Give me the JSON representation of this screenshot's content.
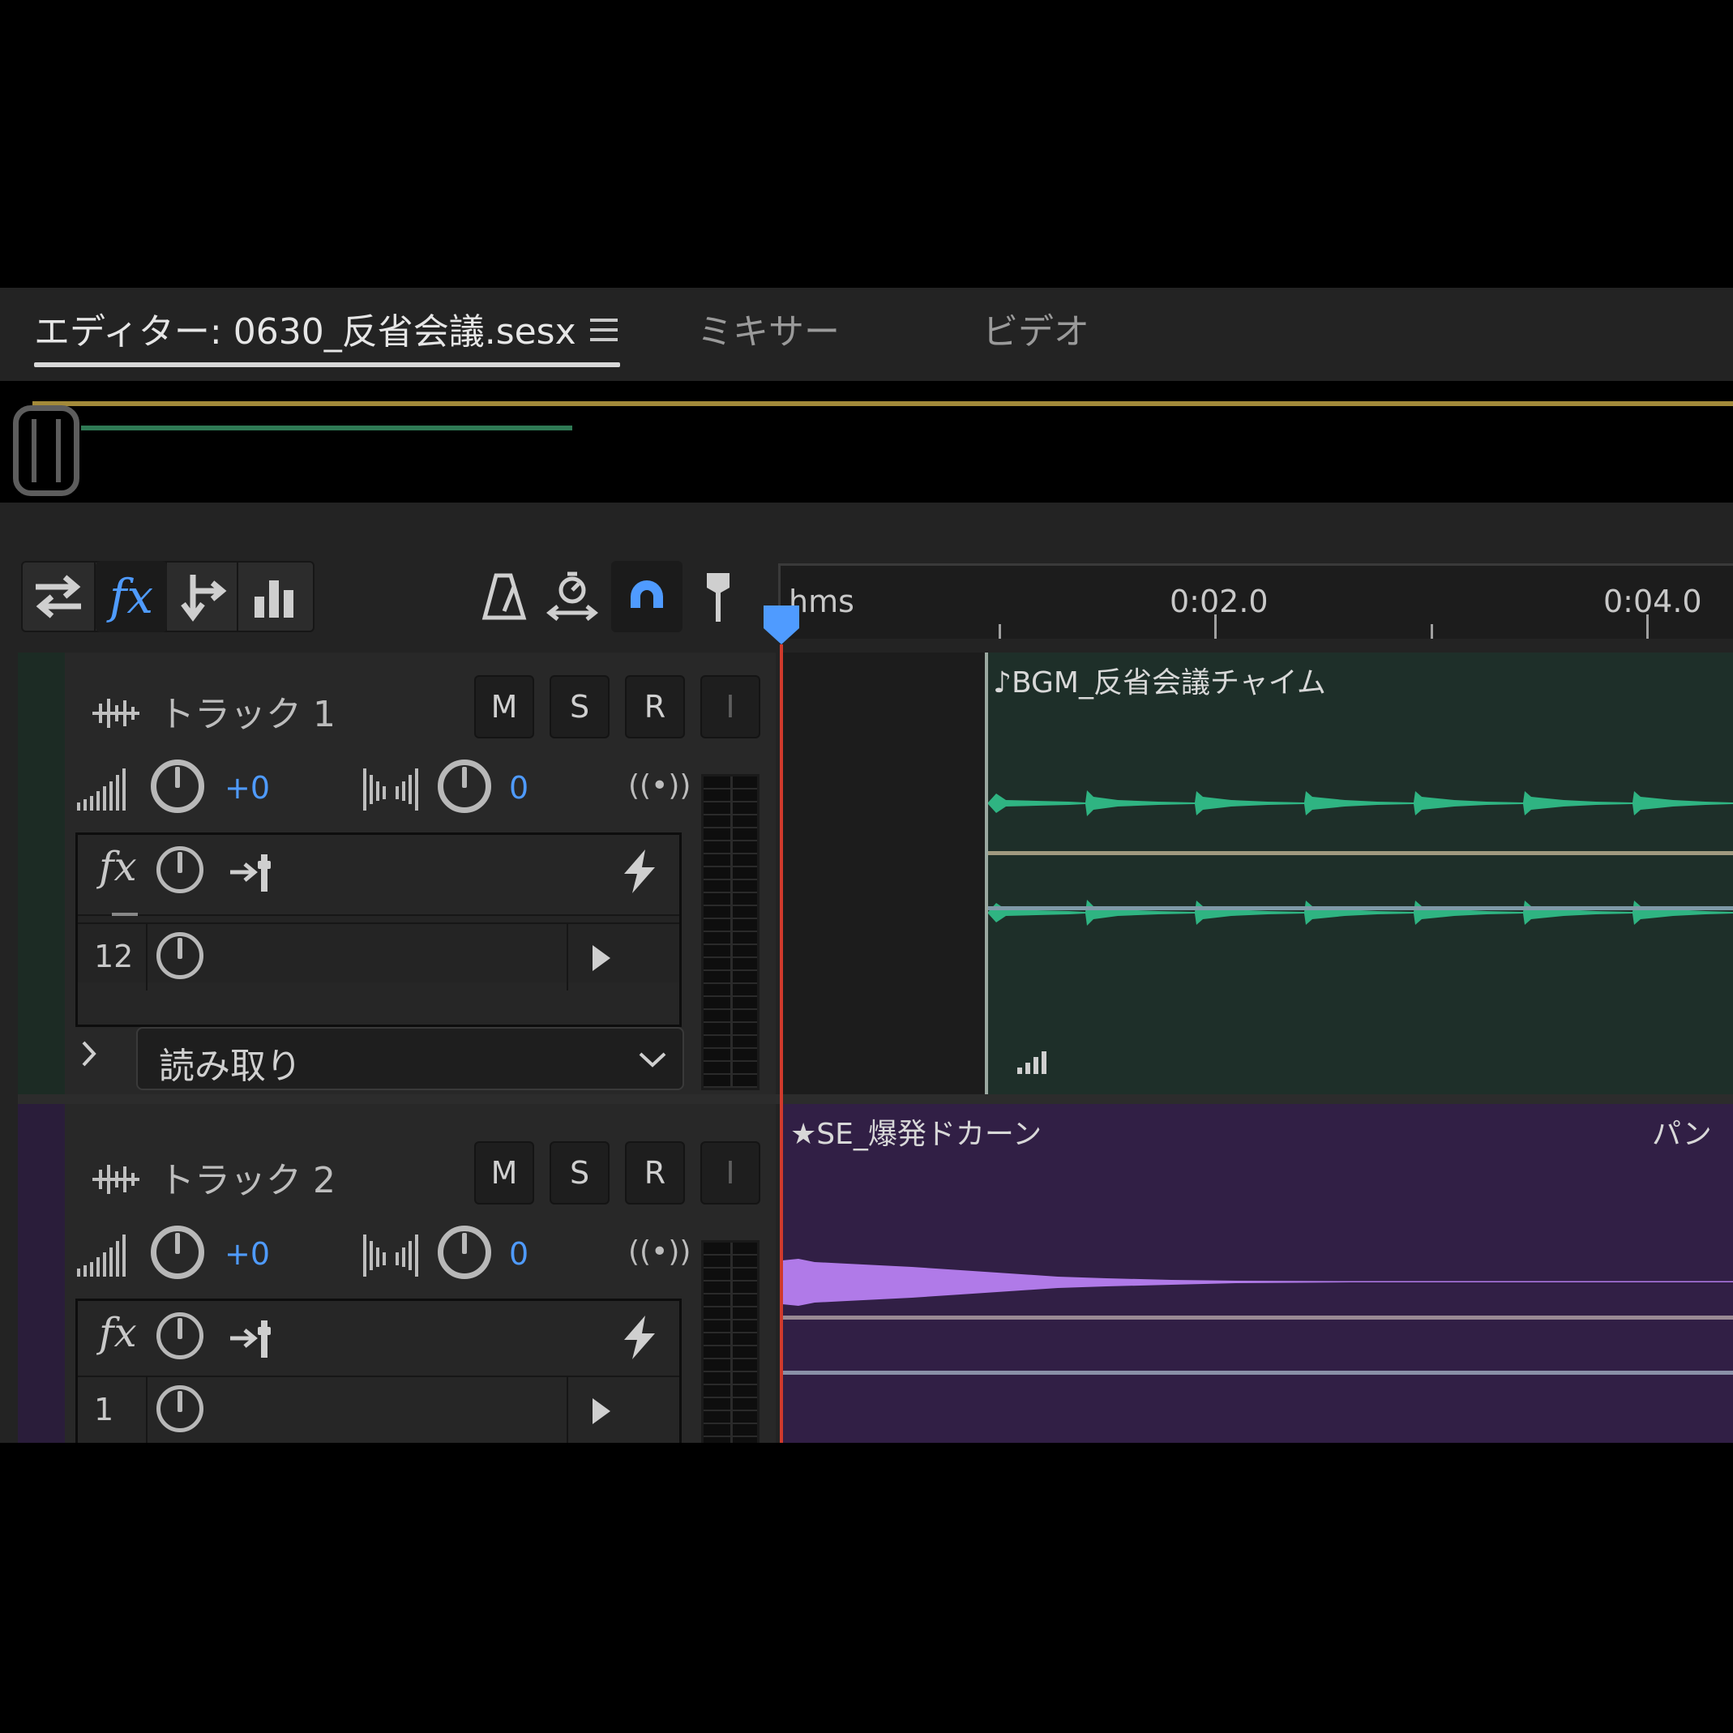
{
  "tabs": {
    "editor": "エディター: 0630_反省会議.sesx",
    "mixer": "ミキサー",
    "video": "ビデオ"
  },
  "ruler": {
    "unit": "hms",
    "labels": [
      "0:02.0",
      "0:04.0"
    ]
  },
  "tracks": [
    {
      "name": "トラック 1",
      "volume": "+0",
      "pan": "0",
      "buttons": [
        "M",
        "S",
        "R",
        "I"
      ],
      "fx_rows": [
        "12"
      ],
      "automation_mode": "読み取り",
      "clip_title": "♪BGM_反省会議チャイム",
      "clip_color": "#1e2f29",
      "wave_color": "#2fb482"
    },
    {
      "name": "トラック 2",
      "volume": "+0",
      "pan": "0",
      "buttons": [
        "M",
        "S",
        "R",
        "I"
      ],
      "fx_rows": [
        "1"
      ],
      "clip_title": "★SE_爆発ドカーン",
      "clip_label_right": "パン",
      "clip_color": "#311f45",
      "wave_color": "#b07ae8"
    }
  ],
  "colors": {
    "accent": "#4f9bff",
    "playhead": "#d03a2c",
    "overview_range": "#a38a3a"
  },
  "icons": {
    "toolbar": [
      "switch-arrows-icon",
      "fx-icon",
      "send-icon",
      "bar-chart-icon",
      "metronome-icon",
      "time-stretch-icon",
      "snap-magnet-icon",
      "marker-pin-icon"
    ]
  }
}
